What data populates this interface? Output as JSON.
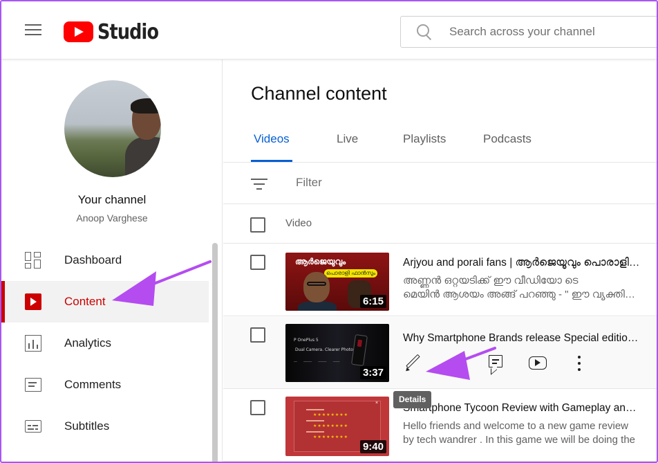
{
  "header": {
    "logo_text": "Studio",
    "search_placeholder": "Search across your channel"
  },
  "sidebar": {
    "channel_title": "Your channel",
    "channel_name": "Anoop Varghese",
    "items": [
      {
        "label": "Dashboard",
        "icon": "dashboard-icon",
        "active": false
      },
      {
        "label": "Content",
        "icon": "content-icon",
        "active": true
      },
      {
        "label": "Analytics",
        "icon": "analytics-icon",
        "active": false
      },
      {
        "label": "Comments",
        "icon": "comments-icon",
        "active": false
      },
      {
        "label": "Subtitles",
        "icon": "subtitles-icon",
        "active": false
      }
    ]
  },
  "main": {
    "title": "Channel content",
    "tabs": [
      {
        "label": "Videos",
        "active": true
      },
      {
        "label": "Live",
        "active": false
      },
      {
        "label": "Playlists",
        "active": false
      },
      {
        "label": "Podcasts",
        "active": false
      }
    ],
    "filter_label": "Filter",
    "column_video": "Video",
    "videos": [
      {
        "title": "Arjyou and porali fans | ആർജെയൂവും പൊരാളി ഫാൻസും",
        "desc_line1": "അണ്ണൻ ഒറ്റയടിക്ക് ഈ വീഡിയോ ടെ",
        "desc_line2": "മെയിൻ ആശയം അങ്ങ് പറഞ്ഞു - \" ഈ വ്യക്തിയെ",
        "duration": "6:15",
        "thumb_text_1": "ആർജെയുവും",
        "thumb_text_2": "പൊരാളി ഫാൻസും"
      },
      {
        "title": "Why Smartphone Brands release Special editions?",
        "duration": "3:37",
        "thumb_text_1": "P OnePlus 5",
        "thumb_text_2": "Dual Camera. Clearer Photos.",
        "thumb_text_3": "── ───── ───── ────"
      },
      {
        "title": "Smartphone Tycoon Review with Gameplay and Tips",
        "desc_line1": "Hello friends and welcome to a new game review",
        "desc_line2": "by tech wandrer . In this game we will be doing the",
        "duration": "9:40",
        "thumb_stars": "★★★★★★★★"
      }
    ],
    "row_actions": [
      "Details",
      "Analytics",
      "Comments",
      "View on YouTube",
      "Options"
    ],
    "tooltip": "Details"
  },
  "colors": {
    "accent_blue": "#065fd4",
    "active_red": "#cc0000",
    "annotation_arrow": "#b44cf0",
    "frame_border": "#a855f7"
  }
}
